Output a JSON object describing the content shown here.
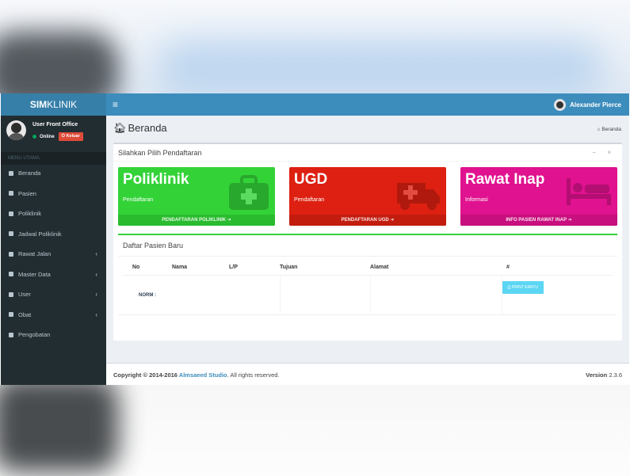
{
  "brand": {
    "bold": "SIM",
    "light": "KLINIK"
  },
  "header": {
    "toggle_glyph": "≡",
    "user_name": "Alexander Pierce"
  },
  "sidebar": {
    "user": {
      "name": "User Front Office",
      "status": "Online",
      "logout": "Keluar"
    },
    "menu_header": "MENU UTAMA",
    "items": [
      {
        "label": "Beranda",
        "has_children": false
      },
      {
        "label": "Pasien",
        "has_children": false
      },
      {
        "label": "Poliklinik",
        "has_children": false
      },
      {
        "label": "Jadwal Poliklinik",
        "has_children": false
      },
      {
        "label": "Rawat Jalan",
        "has_children": true
      },
      {
        "label": "Master Data",
        "has_children": true
      },
      {
        "label": "User",
        "has_children": true
      },
      {
        "label": "Obat",
        "has_children": true
      },
      {
        "label": "Pengobatan",
        "has_children": false
      }
    ]
  },
  "content": {
    "page_title": "Beranda",
    "breadcrumb": "Beranda",
    "box_title": "Silahkan Pilih Pendaftaran",
    "box_tools": "− ×",
    "tiles": [
      {
        "title": "Poliklinik",
        "subtitle": "Pendaftaran",
        "footer": "PENDAFTARAN POLIKLINIK ➔",
        "icon": "medkit-icon",
        "color": "#33d338"
      },
      {
        "title": "UGD",
        "subtitle": "Pendaftaran",
        "footer": "PENDAFTARAN UGD ➔",
        "icon": "ambulance-icon",
        "color": "#dd2011"
      },
      {
        "title": "Rawat Inap",
        "subtitle": "Informasi",
        "footer": "INFO PASIEN RAWAT INAP ➔",
        "icon": "bed-icon",
        "color": "#e0128f"
      }
    ],
    "patients": {
      "title": "Daftar Pasien Baru",
      "columns": [
        "No",
        "Nama",
        "L/P",
        "Tujuan",
        "Alamat",
        "#"
      ],
      "row": {
        "norm_label": "NORM :",
        "print_button": "⎙ PRINT KARTU"
      }
    }
  },
  "footer": {
    "copyright_prefix": "Copyright © 2014-2016 ",
    "company": "Almsaeed Studio",
    "suffix": ". All rights reserved.",
    "version_label": "Version",
    "version": "2.3.6"
  }
}
